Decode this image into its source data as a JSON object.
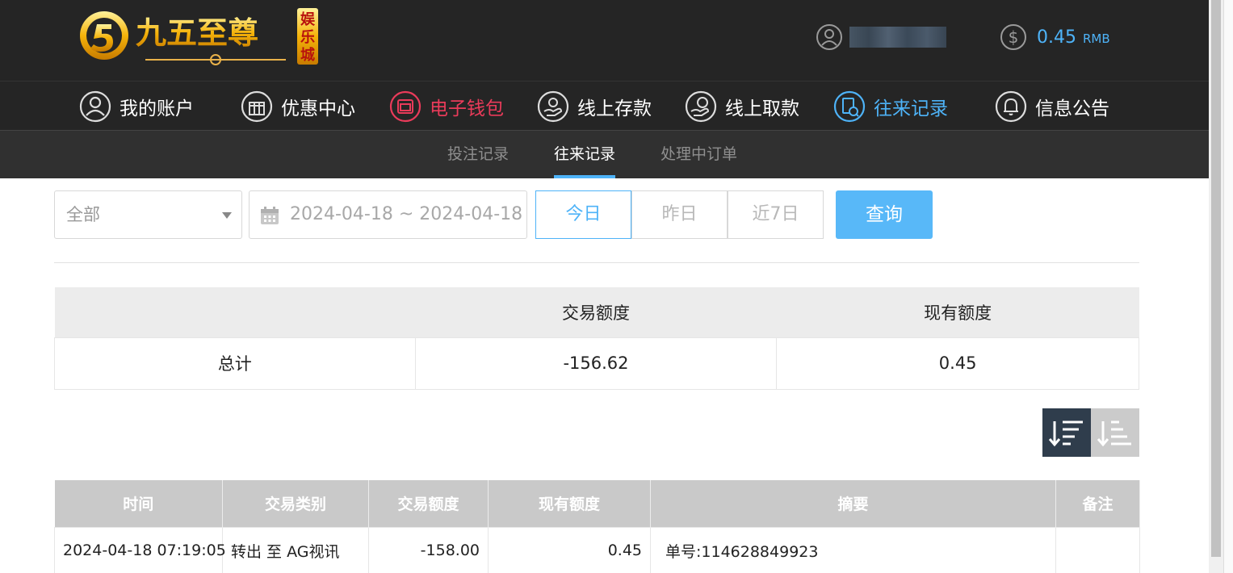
{
  "header": {
    "logo_text": "九五至尊",
    "logo_badge": "娱乐城",
    "balance_amount": "0.45",
    "balance_unit": "RMB"
  },
  "nav": {
    "items": [
      {
        "label": "我的账户",
        "icon": "user-icon"
      },
      {
        "label": "优惠中心",
        "icon": "gift-icon"
      },
      {
        "label": "电子钱包",
        "icon": "wallet-icon"
      },
      {
        "label": "线上存款",
        "icon": "deposit-icon"
      },
      {
        "label": "线上取款",
        "icon": "withdraw-icon"
      },
      {
        "label": "往来记录",
        "icon": "records-icon"
      },
      {
        "label": "信息公告",
        "icon": "bell-icon"
      }
    ]
  },
  "subnav": {
    "tabs": [
      "投注记录",
      "往来记录",
      "处理中订单"
    ],
    "active": "往来记录"
  },
  "filters": {
    "type_select": "全部",
    "date_range": "2024-04-18 ~ 2024-04-18",
    "quick_ranges": [
      "今日",
      "昨日",
      "近7日"
    ],
    "active_range": "今日",
    "query_label": "查询"
  },
  "summary": {
    "headers": [
      "",
      "交易额度",
      "现有额度"
    ],
    "row": {
      "label": "总计",
      "amount": "-156.62",
      "balance": "0.45"
    }
  },
  "records": {
    "headers": [
      "时间",
      "交易类别",
      "交易额度",
      "现有额度",
      "摘要",
      "备注"
    ],
    "rows": [
      [
        "2024-04-18 07:19:05",
        "转出 至 AG视讯",
        "-158.00",
        "0.45",
        "单号:114628849923",
        ""
      ]
    ]
  },
  "colors": {
    "accent_blue": "#4eb3f8",
    "accent_red": "#ea3b5a",
    "header_bg": "#252525",
    "gold": "#f5b30a"
  }
}
